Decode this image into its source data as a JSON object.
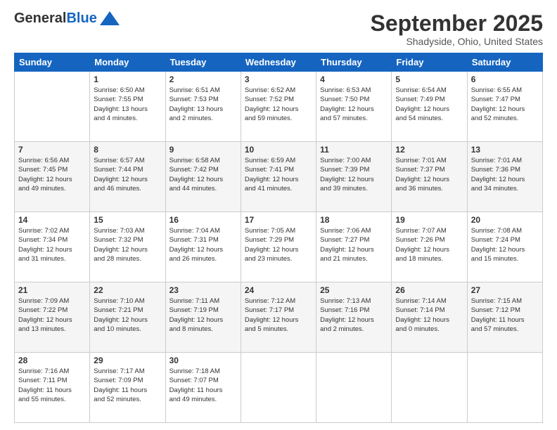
{
  "header": {
    "logo_general": "General",
    "logo_blue": "Blue",
    "month": "September 2025",
    "location": "Shadyside, Ohio, United States"
  },
  "days_of_week": [
    "Sunday",
    "Monday",
    "Tuesday",
    "Wednesday",
    "Thursday",
    "Friday",
    "Saturday"
  ],
  "weeks": [
    [
      {
        "day": "",
        "info": ""
      },
      {
        "day": "1",
        "info": "Sunrise: 6:50 AM\nSunset: 7:55 PM\nDaylight: 13 hours\nand 4 minutes."
      },
      {
        "day": "2",
        "info": "Sunrise: 6:51 AM\nSunset: 7:53 PM\nDaylight: 13 hours\nand 2 minutes."
      },
      {
        "day": "3",
        "info": "Sunrise: 6:52 AM\nSunset: 7:52 PM\nDaylight: 12 hours\nand 59 minutes."
      },
      {
        "day": "4",
        "info": "Sunrise: 6:53 AM\nSunset: 7:50 PM\nDaylight: 12 hours\nand 57 minutes."
      },
      {
        "day": "5",
        "info": "Sunrise: 6:54 AM\nSunset: 7:49 PM\nDaylight: 12 hours\nand 54 minutes."
      },
      {
        "day": "6",
        "info": "Sunrise: 6:55 AM\nSunset: 7:47 PM\nDaylight: 12 hours\nand 52 minutes."
      }
    ],
    [
      {
        "day": "7",
        "info": "Sunrise: 6:56 AM\nSunset: 7:45 PM\nDaylight: 12 hours\nand 49 minutes."
      },
      {
        "day": "8",
        "info": "Sunrise: 6:57 AM\nSunset: 7:44 PM\nDaylight: 12 hours\nand 46 minutes."
      },
      {
        "day": "9",
        "info": "Sunrise: 6:58 AM\nSunset: 7:42 PM\nDaylight: 12 hours\nand 44 minutes."
      },
      {
        "day": "10",
        "info": "Sunrise: 6:59 AM\nSunset: 7:41 PM\nDaylight: 12 hours\nand 41 minutes."
      },
      {
        "day": "11",
        "info": "Sunrise: 7:00 AM\nSunset: 7:39 PM\nDaylight: 12 hours\nand 39 minutes."
      },
      {
        "day": "12",
        "info": "Sunrise: 7:01 AM\nSunset: 7:37 PM\nDaylight: 12 hours\nand 36 minutes."
      },
      {
        "day": "13",
        "info": "Sunrise: 7:01 AM\nSunset: 7:36 PM\nDaylight: 12 hours\nand 34 minutes."
      }
    ],
    [
      {
        "day": "14",
        "info": "Sunrise: 7:02 AM\nSunset: 7:34 PM\nDaylight: 12 hours\nand 31 minutes."
      },
      {
        "day": "15",
        "info": "Sunrise: 7:03 AM\nSunset: 7:32 PM\nDaylight: 12 hours\nand 28 minutes."
      },
      {
        "day": "16",
        "info": "Sunrise: 7:04 AM\nSunset: 7:31 PM\nDaylight: 12 hours\nand 26 minutes."
      },
      {
        "day": "17",
        "info": "Sunrise: 7:05 AM\nSunset: 7:29 PM\nDaylight: 12 hours\nand 23 minutes."
      },
      {
        "day": "18",
        "info": "Sunrise: 7:06 AM\nSunset: 7:27 PM\nDaylight: 12 hours\nand 21 minutes."
      },
      {
        "day": "19",
        "info": "Sunrise: 7:07 AM\nSunset: 7:26 PM\nDaylight: 12 hours\nand 18 minutes."
      },
      {
        "day": "20",
        "info": "Sunrise: 7:08 AM\nSunset: 7:24 PM\nDaylight: 12 hours\nand 15 minutes."
      }
    ],
    [
      {
        "day": "21",
        "info": "Sunrise: 7:09 AM\nSunset: 7:22 PM\nDaylight: 12 hours\nand 13 minutes."
      },
      {
        "day": "22",
        "info": "Sunrise: 7:10 AM\nSunset: 7:21 PM\nDaylight: 12 hours\nand 10 minutes."
      },
      {
        "day": "23",
        "info": "Sunrise: 7:11 AM\nSunset: 7:19 PM\nDaylight: 12 hours\nand 8 minutes."
      },
      {
        "day": "24",
        "info": "Sunrise: 7:12 AM\nSunset: 7:17 PM\nDaylight: 12 hours\nand 5 minutes."
      },
      {
        "day": "25",
        "info": "Sunrise: 7:13 AM\nSunset: 7:16 PM\nDaylight: 12 hours\nand 2 minutes."
      },
      {
        "day": "26",
        "info": "Sunrise: 7:14 AM\nSunset: 7:14 PM\nDaylight: 12 hours\nand 0 minutes."
      },
      {
        "day": "27",
        "info": "Sunrise: 7:15 AM\nSunset: 7:12 PM\nDaylight: 11 hours\nand 57 minutes."
      }
    ],
    [
      {
        "day": "28",
        "info": "Sunrise: 7:16 AM\nSunset: 7:11 PM\nDaylight: 11 hours\nand 55 minutes."
      },
      {
        "day": "29",
        "info": "Sunrise: 7:17 AM\nSunset: 7:09 PM\nDaylight: 11 hours\nand 52 minutes."
      },
      {
        "day": "30",
        "info": "Sunrise: 7:18 AM\nSunset: 7:07 PM\nDaylight: 11 hours\nand 49 minutes."
      },
      {
        "day": "",
        "info": ""
      },
      {
        "day": "",
        "info": ""
      },
      {
        "day": "",
        "info": ""
      },
      {
        "day": "",
        "info": ""
      }
    ]
  ]
}
